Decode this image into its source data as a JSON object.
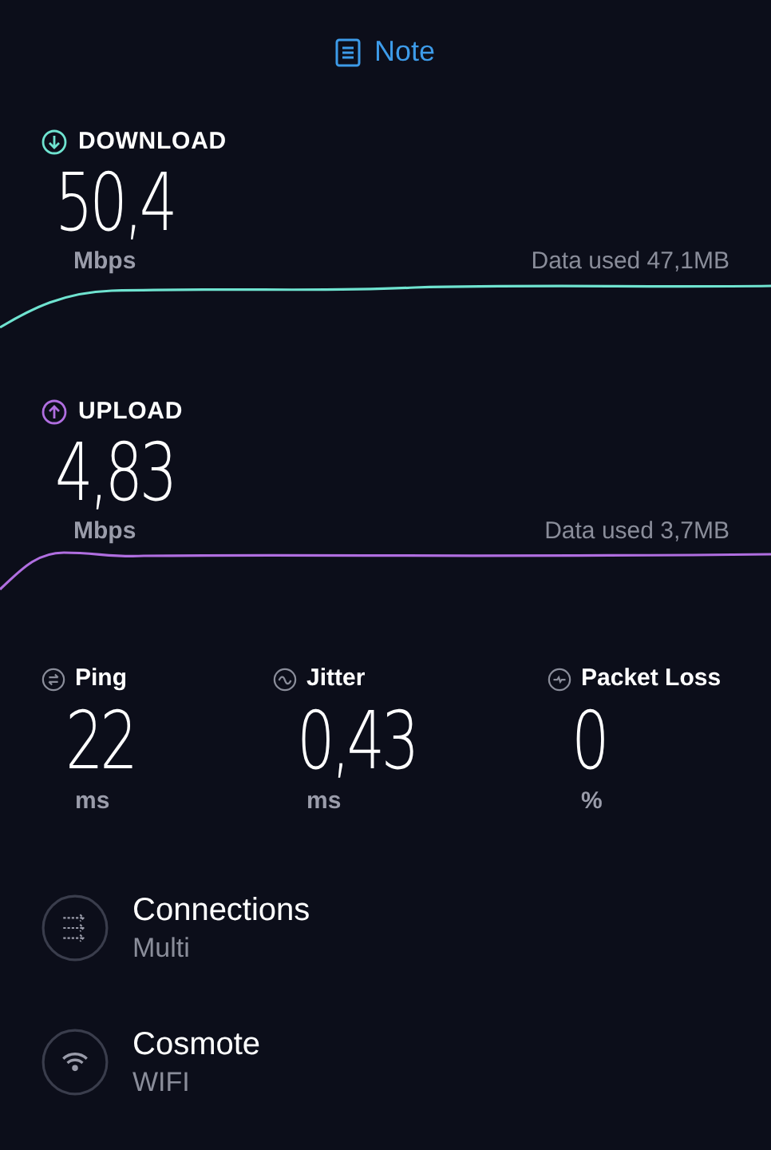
{
  "header": {
    "label": "Note"
  },
  "speeds": [
    {
      "kind": "download",
      "label": "DOWNLOAD",
      "value": "50,4",
      "unit": "Mbps",
      "data_used": "Data used 47,1MB",
      "color": "#6fe3d0"
    },
    {
      "kind": "upload",
      "label": "UPLOAD",
      "value": "4,83",
      "unit": "Mbps",
      "data_used": "Data used 3,7MB",
      "color": "#b06ee0"
    }
  ],
  "stats": [
    {
      "kind": "ping",
      "label": "Ping",
      "value": "22",
      "unit": "ms"
    },
    {
      "kind": "jitter",
      "label": "Jitter",
      "value": "0,43",
      "unit": "ms"
    },
    {
      "kind": "loss",
      "label": "Packet Loss",
      "value": "0",
      "unit": "%"
    }
  ],
  "info": [
    {
      "kind": "connections",
      "title": "Connections",
      "subtitle": "Multi"
    },
    {
      "kind": "wifi",
      "title": "Cosmote",
      "subtitle": "WIFI"
    }
  ]
}
